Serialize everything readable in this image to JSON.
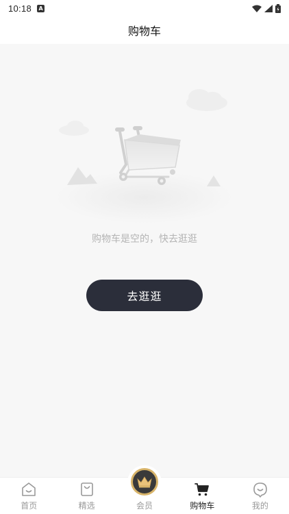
{
  "status_bar": {
    "time": "10:18",
    "notification_icon": "A"
  },
  "header": {
    "title": "购物车"
  },
  "empty_state": {
    "message": "购物车是空的，快去逛逛",
    "button_label": "去逛逛"
  },
  "tabbar": {
    "items": [
      {
        "label": "首页",
        "icon": "home-smile-icon",
        "active": false
      },
      {
        "label": "精选",
        "icon": "shopping-bag-icon",
        "active": false
      },
      {
        "label": "会员",
        "icon": "crown-icon",
        "active": false
      },
      {
        "label": "购物车",
        "icon": "cart-icon",
        "active": true
      },
      {
        "label": "我的",
        "icon": "profile-face-icon",
        "active": false
      }
    ]
  },
  "colors": {
    "button_bg": "#2b2e3a",
    "member_ring": "#d8b46a",
    "page_bg": "#f7f7f7"
  }
}
